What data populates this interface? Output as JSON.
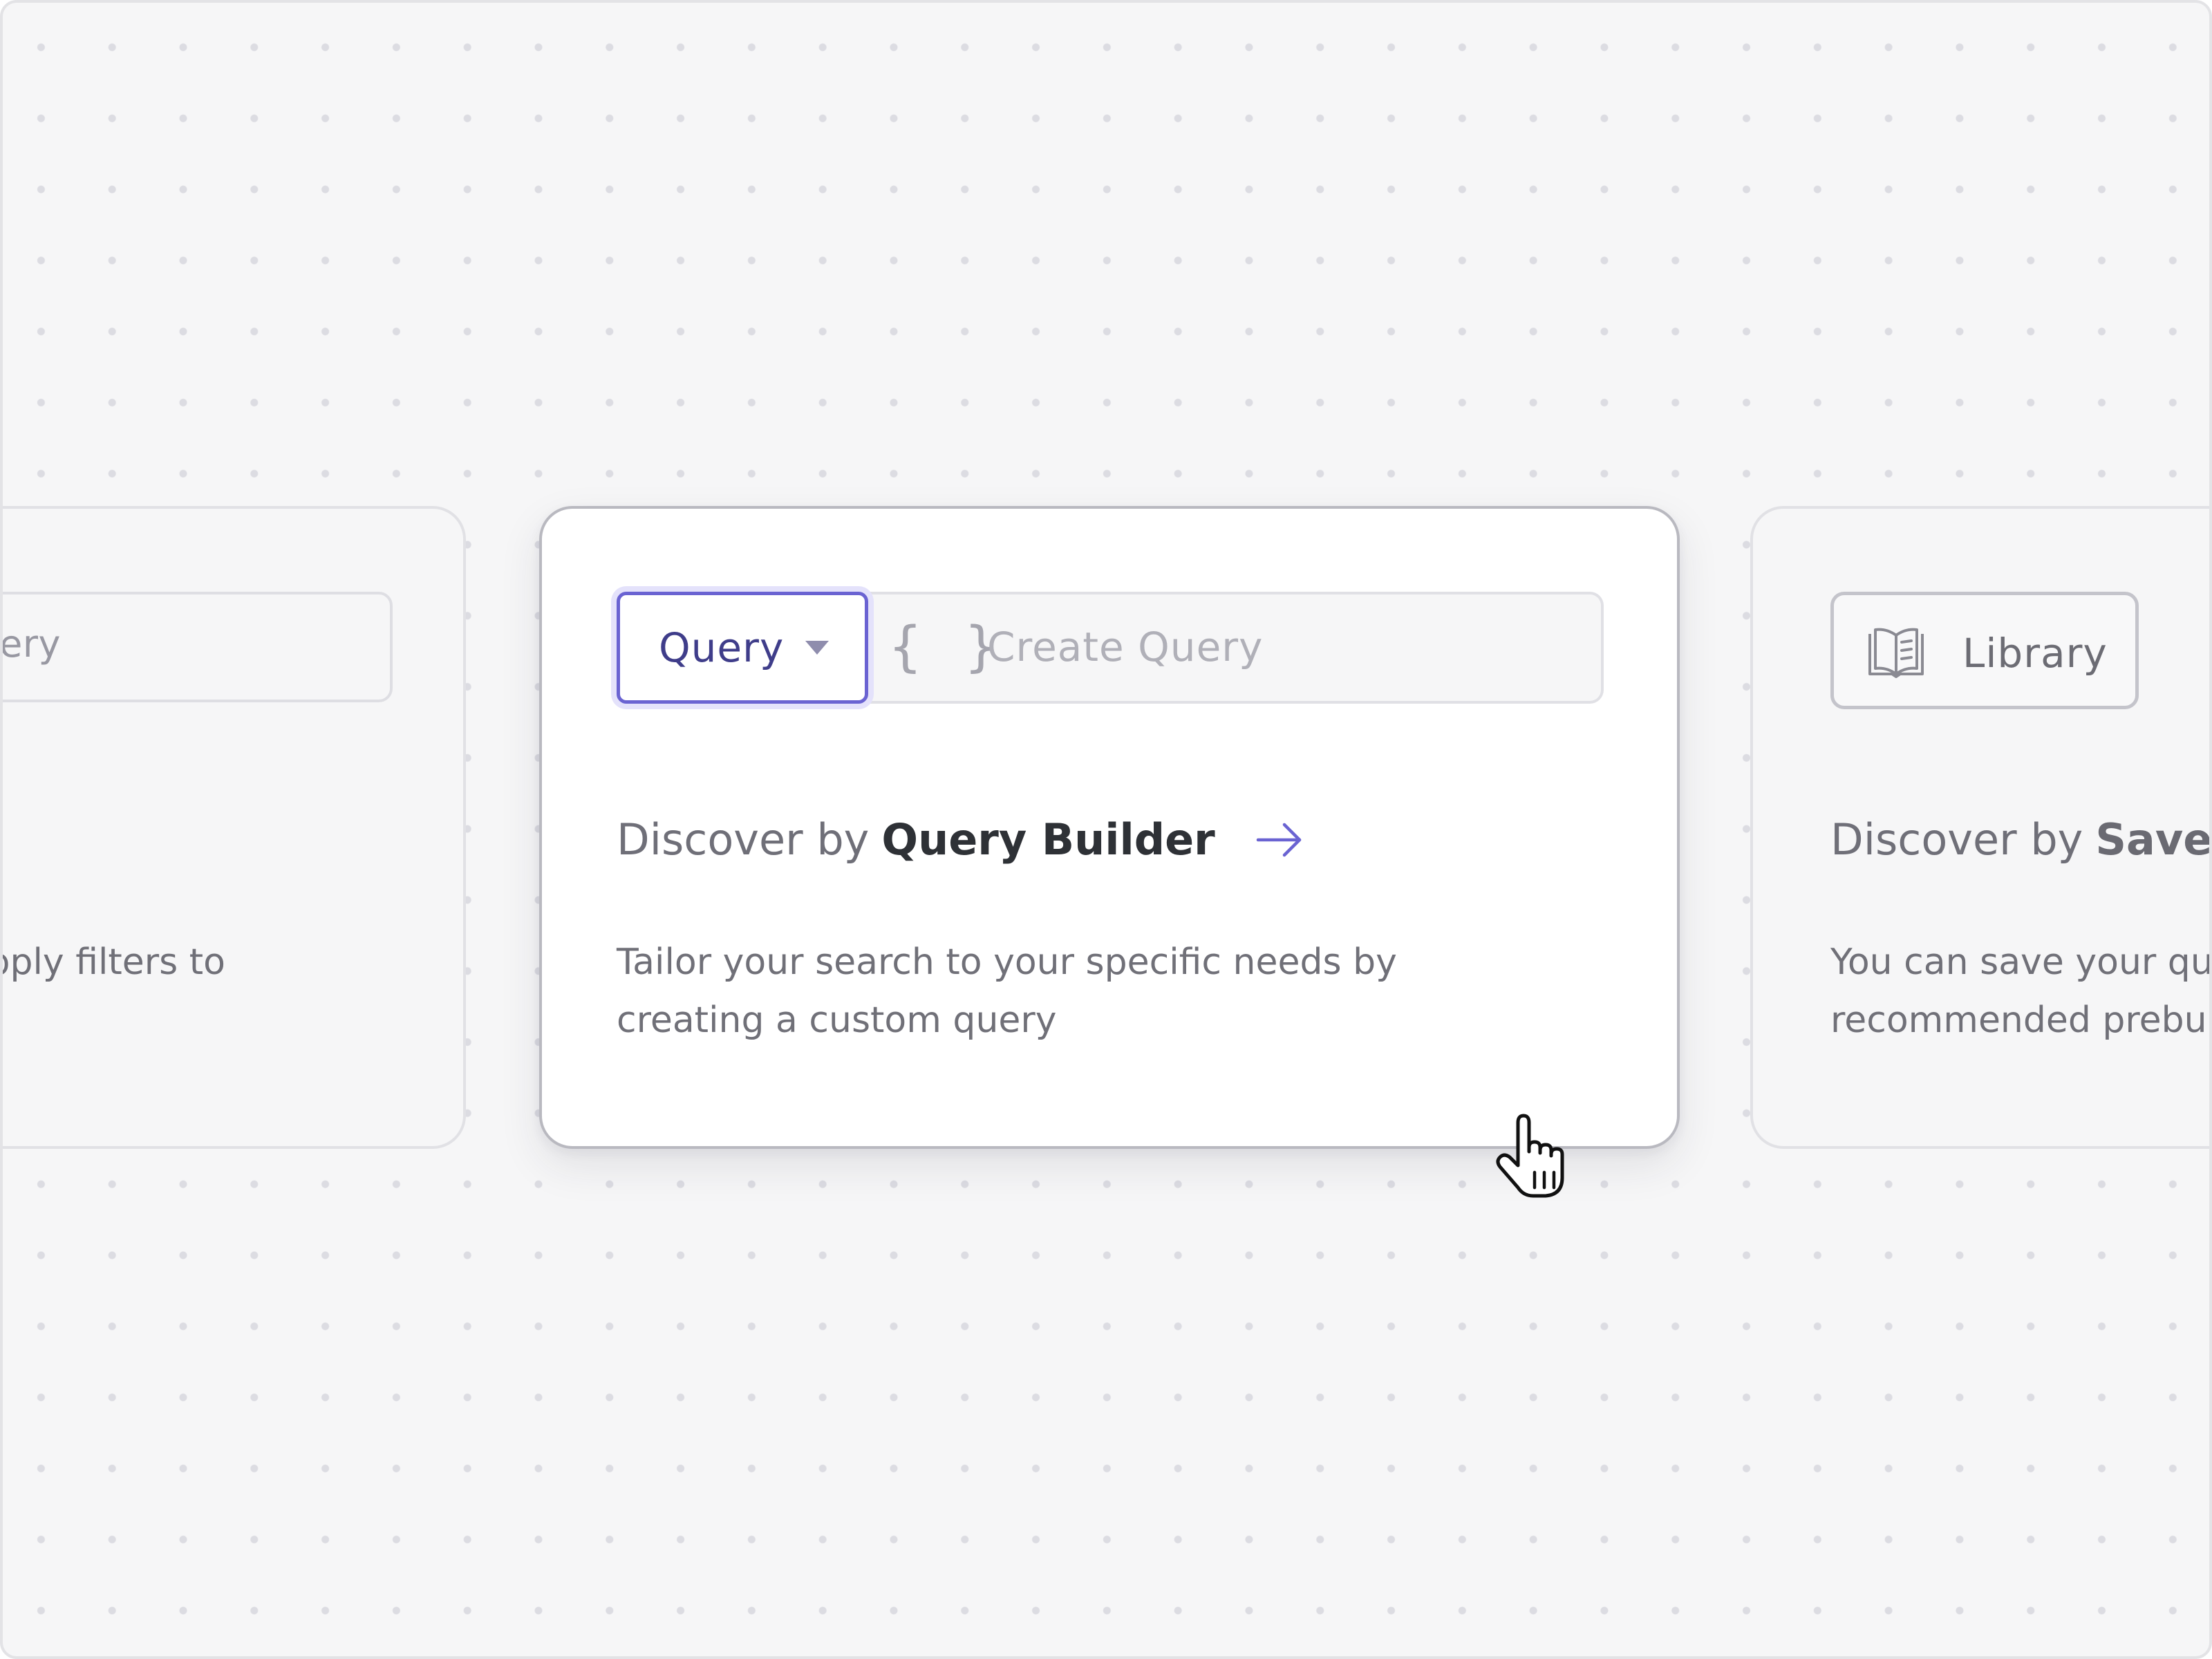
{
  "left_card": {
    "input_text": "ery",
    "desc_line": "pply filters to"
  },
  "center_card": {
    "dropdown_label": "Query",
    "input_placeholder": "Create Query",
    "braces_icon": "{ }",
    "discover_prefix": "Discover by",
    "discover_strong": "Query Builder",
    "desc_lines": [
      "Tailor your search to your specific needs by",
      "creating a custom query"
    ]
  },
  "right_card": {
    "button_label": "Library",
    "discover_prefix": "Discover by",
    "discover_strong": "Saved",
    "desc_lines": [
      "You can save your qu",
      "recommended prebu"
    ]
  },
  "icons": {
    "dropdown": "caret-down-icon",
    "input": "braces-icon",
    "link": "arrow-right-icon",
    "library": "book-icon",
    "pointer": "hand-pointer-icon"
  },
  "colors": {
    "accent": "#6a63d2",
    "accent_text": "#3f3d8a",
    "focus_ring": "#e4e2fb",
    "heading": "#2e3136",
    "body_text": "#707078",
    "placeholder": "#b0b0b8",
    "background": "#f6f6f7"
  }
}
